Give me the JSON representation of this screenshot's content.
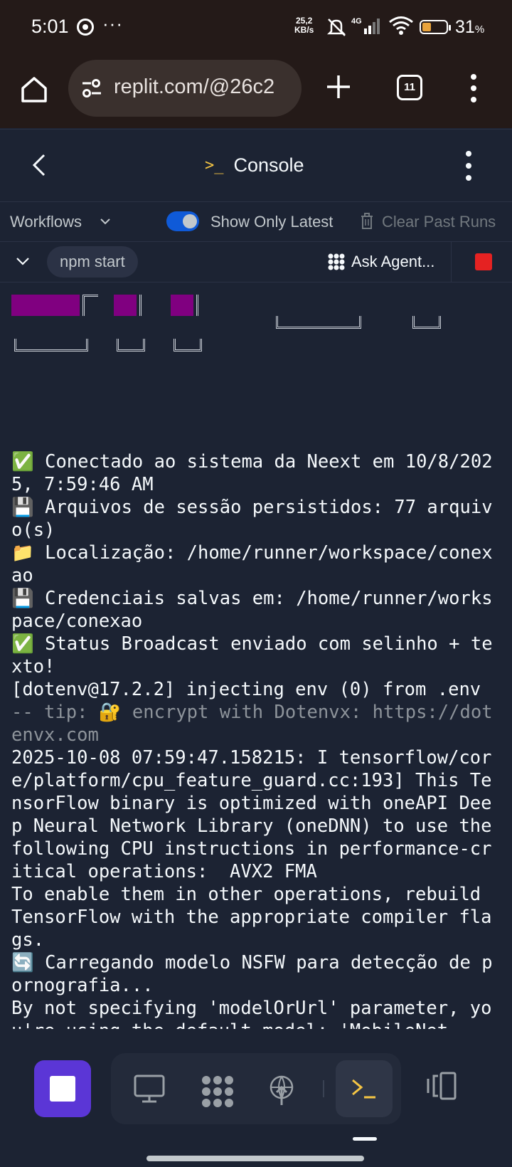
{
  "status_bar": {
    "time": "5:01",
    "more": "···",
    "net_speed_value": "25,2",
    "net_speed_unit": "KB/s",
    "network": "4G",
    "battery": "31",
    "battery_unit": "%"
  },
  "browser": {
    "url": "replit.com/@26c2",
    "tab_count": "11"
  },
  "console_header": {
    "title_icon": ">_",
    "title": "Console"
  },
  "workflows": {
    "label": "Workflows",
    "toggle_label": "Show Only Latest",
    "toggle_on": true,
    "clear_label": "Clear Past Runs"
  },
  "run": {
    "command": "npm start",
    "agent_label": "Ask Agent..."
  },
  "console": {
    "lines_before_tip": "✅ Conectado ao sistema da Neext em 10/8/2025, 7:59:46 AM\n💾 Arquivos de sessão persistidos: 77 arquivo(s)\n📁 Localização: /home/runner/workspace/conexao\n💾 Credenciais salvas em: /home/runner/workspace/conexao\n✅ Status Broadcast enviado com selinho + texto!\n[dotenv@17.2.2] injecting env (0) from .env ",
    "tip": "-- tip: 🔐 encrypt with Dotenvx: https://dotenvx.com",
    "lines_after_tip": "\n2025-10-08 07:59:47.158215: I tensorflow/core/platform/cpu_feature_guard.cc:193] This TensorFlow binary is optimized with oneAPI Deep Neural Network Library (oneDNN) to use the following CPU instructions in performance-critical operations:  AVX2 FMA\nTo enable them in other operations, rebuild TensorFlow with the appropriate compiler flags.\n🔄 Carregando modelo NSFW para detecção de pornografia...\nBy not specifying 'modelOrUrl' parameter, you're using the default model: 'MobileNet"
  },
  "colors": {
    "background": "#1c2333",
    "banner": "#800080",
    "accent": "#5b36d6",
    "stop": "#e52222",
    "toggle": "#0f5ad8"
  },
  "icons": [
    "home-icon",
    "site-settings-icon",
    "plus-icon",
    "tabs-icon",
    "menu-icon",
    "back-icon",
    "terminal-icon",
    "chevron-down-icon",
    "trash-icon",
    "agent-icon",
    "stop-icon",
    "webview-icon",
    "agent-tool-icon",
    "deploy-icon",
    "console-icon",
    "panels-icon"
  ]
}
